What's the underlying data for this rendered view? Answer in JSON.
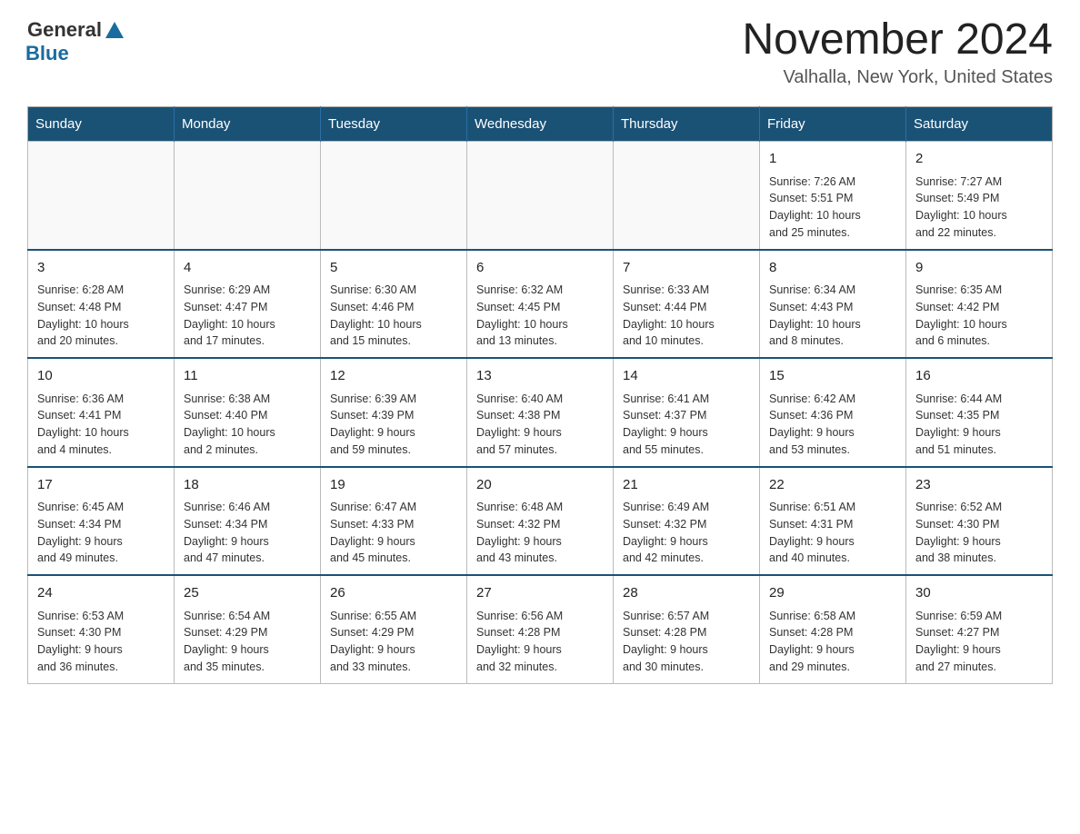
{
  "header": {
    "logo_general": "General",
    "logo_blue": "Blue",
    "month_title": "November 2024",
    "location": "Valhalla, New York, United States"
  },
  "days_of_week": [
    "Sunday",
    "Monday",
    "Tuesday",
    "Wednesday",
    "Thursday",
    "Friday",
    "Saturday"
  ],
  "weeks": [
    [
      {
        "day": "",
        "info": ""
      },
      {
        "day": "",
        "info": ""
      },
      {
        "day": "",
        "info": ""
      },
      {
        "day": "",
        "info": ""
      },
      {
        "day": "",
        "info": ""
      },
      {
        "day": "1",
        "info": "Sunrise: 7:26 AM\nSunset: 5:51 PM\nDaylight: 10 hours\nand 25 minutes."
      },
      {
        "day": "2",
        "info": "Sunrise: 7:27 AM\nSunset: 5:49 PM\nDaylight: 10 hours\nand 22 minutes."
      }
    ],
    [
      {
        "day": "3",
        "info": "Sunrise: 6:28 AM\nSunset: 4:48 PM\nDaylight: 10 hours\nand 20 minutes."
      },
      {
        "day": "4",
        "info": "Sunrise: 6:29 AM\nSunset: 4:47 PM\nDaylight: 10 hours\nand 17 minutes."
      },
      {
        "day": "5",
        "info": "Sunrise: 6:30 AM\nSunset: 4:46 PM\nDaylight: 10 hours\nand 15 minutes."
      },
      {
        "day": "6",
        "info": "Sunrise: 6:32 AM\nSunset: 4:45 PM\nDaylight: 10 hours\nand 13 minutes."
      },
      {
        "day": "7",
        "info": "Sunrise: 6:33 AM\nSunset: 4:44 PM\nDaylight: 10 hours\nand 10 minutes."
      },
      {
        "day": "8",
        "info": "Sunrise: 6:34 AM\nSunset: 4:43 PM\nDaylight: 10 hours\nand 8 minutes."
      },
      {
        "day": "9",
        "info": "Sunrise: 6:35 AM\nSunset: 4:42 PM\nDaylight: 10 hours\nand 6 minutes."
      }
    ],
    [
      {
        "day": "10",
        "info": "Sunrise: 6:36 AM\nSunset: 4:41 PM\nDaylight: 10 hours\nand 4 minutes."
      },
      {
        "day": "11",
        "info": "Sunrise: 6:38 AM\nSunset: 4:40 PM\nDaylight: 10 hours\nand 2 minutes."
      },
      {
        "day": "12",
        "info": "Sunrise: 6:39 AM\nSunset: 4:39 PM\nDaylight: 9 hours\nand 59 minutes."
      },
      {
        "day": "13",
        "info": "Sunrise: 6:40 AM\nSunset: 4:38 PM\nDaylight: 9 hours\nand 57 minutes."
      },
      {
        "day": "14",
        "info": "Sunrise: 6:41 AM\nSunset: 4:37 PM\nDaylight: 9 hours\nand 55 minutes."
      },
      {
        "day": "15",
        "info": "Sunrise: 6:42 AM\nSunset: 4:36 PM\nDaylight: 9 hours\nand 53 minutes."
      },
      {
        "day": "16",
        "info": "Sunrise: 6:44 AM\nSunset: 4:35 PM\nDaylight: 9 hours\nand 51 minutes."
      }
    ],
    [
      {
        "day": "17",
        "info": "Sunrise: 6:45 AM\nSunset: 4:34 PM\nDaylight: 9 hours\nand 49 minutes."
      },
      {
        "day": "18",
        "info": "Sunrise: 6:46 AM\nSunset: 4:34 PM\nDaylight: 9 hours\nand 47 minutes."
      },
      {
        "day": "19",
        "info": "Sunrise: 6:47 AM\nSunset: 4:33 PM\nDaylight: 9 hours\nand 45 minutes."
      },
      {
        "day": "20",
        "info": "Sunrise: 6:48 AM\nSunset: 4:32 PM\nDaylight: 9 hours\nand 43 minutes."
      },
      {
        "day": "21",
        "info": "Sunrise: 6:49 AM\nSunset: 4:32 PM\nDaylight: 9 hours\nand 42 minutes."
      },
      {
        "day": "22",
        "info": "Sunrise: 6:51 AM\nSunset: 4:31 PM\nDaylight: 9 hours\nand 40 minutes."
      },
      {
        "day": "23",
        "info": "Sunrise: 6:52 AM\nSunset: 4:30 PM\nDaylight: 9 hours\nand 38 minutes."
      }
    ],
    [
      {
        "day": "24",
        "info": "Sunrise: 6:53 AM\nSunset: 4:30 PM\nDaylight: 9 hours\nand 36 minutes."
      },
      {
        "day": "25",
        "info": "Sunrise: 6:54 AM\nSunset: 4:29 PM\nDaylight: 9 hours\nand 35 minutes."
      },
      {
        "day": "26",
        "info": "Sunrise: 6:55 AM\nSunset: 4:29 PM\nDaylight: 9 hours\nand 33 minutes."
      },
      {
        "day": "27",
        "info": "Sunrise: 6:56 AM\nSunset: 4:28 PM\nDaylight: 9 hours\nand 32 minutes."
      },
      {
        "day": "28",
        "info": "Sunrise: 6:57 AM\nSunset: 4:28 PM\nDaylight: 9 hours\nand 30 minutes."
      },
      {
        "day": "29",
        "info": "Sunrise: 6:58 AM\nSunset: 4:28 PM\nDaylight: 9 hours\nand 29 minutes."
      },
      {
        "day": "30",
        "info": "Sunrise: 6:59 AM\nSunset: 4:27 PM\nDaylight: 9 hours\nand 27 minutes."
      }
    ]
  ]
}
